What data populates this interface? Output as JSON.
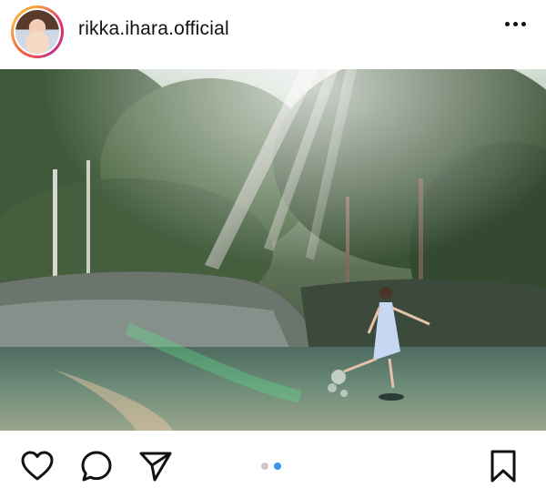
{
  "post": {
    "username": "rikka.ihara.official",
    "avatar": "profile-photo",
    "more_icon": "more-horizontal-icon",
    "photo": "woman-in-dress-splashing-water-in-forest-river-with-sun-rays"
  },
  "carousel": {
    "total": 2,
    "current": 2
  },
  "actions": {
    "like_icon": "heart-icon",
    "comment_icon": "comment-bubble-icon",
    "share_icon": "paper-plane-icon",
    "save_icon": "bookmark-icon"
  },
  "colors": {
    "accent": "#3897f0",
    "inactive_dot": "#c9c9c9"
  }
}
